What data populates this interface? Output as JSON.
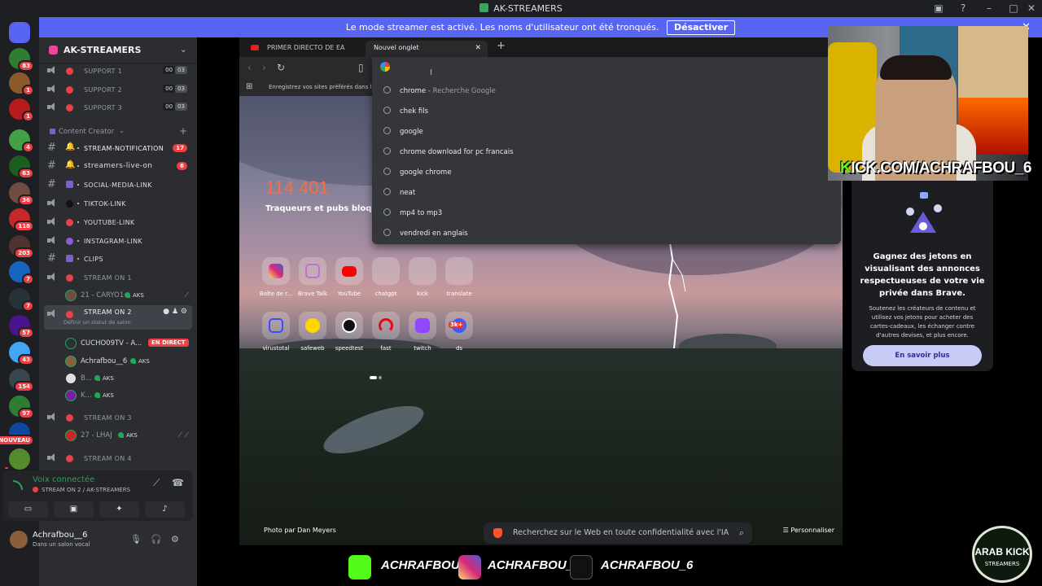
{
  "window": {
    "title": "AK-STREAMERS"
  },
  "banner": {
    "text": "Le mode streamer est activé. Les noms d'utilisateur ont été tronqués.",
    "button": "Désactiver"
  },
  "guild_badges": [
    "83",
    "1",
    "1",
    "4",
    "63",
    "36",
    "118",
    "203",
    "7",
    "7",
    "57",
    "43",
    "154",
    "97",
    "NOUVEAU"
  ],
  "server": {
    "name": "AK-STREAMERS"
  },
  "channels": {
    "support1": {
      "label": "SUPPORT 1",
      "c1": "00",
      "c2": "03"
    },
    "support2": {
      "label": "SUPPORT 2",
      "c1": "00",
      "c2": "03"
    },
    "support3": {
      "label": "SUPPORT 3",
      "c1": "00",
      "c2": "03"
    },
    "category": "Content Creator",
    "stream_notification": {
      "label": "STREAM-NOTIFICATION",
      "badge": "17"
    },
    "streamers_live_on": {
      "label": "streamers-live-on",
      "badge": "6"
    },
    "social_media_link": {
      "label": "SOCIAL-MEDIA-LINK"
    },
    "tiktok_link": {
      "label": "TIKTOK-LINK"
    },
    "youtube_link": {
      "label": "YOUTUBE-LINK"
    },
    "instagram_link": {
      "label": "INSTAGRAM-LINK"
    },
    "clips": {
      "label": "CLIPS"
    },
    "stream_on_1": {
      "label": "STREAM ON 1"
    },
    "stream_on_2": {
      "label": "STREAM ON 2",
      "status": "Définir un statut de salon"
    },
    "stream_on_3": {
      "label": "STREAM ON 3"
    },
    "stream_on_4": {
      "label": "STREAM ON 4"
    }
  },
  "voice_users": {
    "caryo": {
      "name": "21 - CARYO1",
      "tag": "AKS"
    },
    "cucho": {
      "name": "CUCHO09TV - A...",
      "live": "EN DIRECT"
    },
    "achraf": {
      "name": "Achrafbou__6",
      "tag": "AKS"
    },
    "b": {
      "name": "B...",
      "tag": "AKS"
    },
    "k": {
      "name": "K...",
      "tag": "AKS"
    },
    "lhaj": {
      "name": "27 - LHAJ",
      "tag": "AKS"
    }
  },
  "voice_panel": {
    "status": "Voix connectée",
    "channel": "STREAM ON 2 / AK-STREAMERS"
  },
  "user_panel": {
    "name": "Achrafbou__6",
    "status": "Dans un salon vocal"
  },
  "browser": {
    "tab1": "PRIMER DIRECTO DE EA SPORTS",
    "tab2": "Nouvel onglet",
    "bookmarks_hint": "Enregistrez vos sites préférés dans la b",
    "suggestions": [
      {
        "text": "chrome",
        "sub": " - Recherche Google"
      },
      {
        "text": "chek fils",
        "sub": ""
      },
      {
        "text": "google",
        "sub": ""
      },
      {
        "text": "chrome download for pc francais",
        "sub": ""
      },
      {
        "text": "google chrome",
        "sub": ""
      },
      {
        "text": "neat",
        "sub": ""
      },
      {
        "text": "mp4 to mp3",
        "sub": ""
      },
      {
        "text": "vendredi en anglais",
        "sub": ""
      }
    ],
    "stats_number": "114 401",
    "stats_label": "Traqueurs et pubs bloqué",
    "tiles_row1": [
      "Boîte de r...",
      "Brave Talk",
      "YouTube",
      "chatgpt",
      "kick",
      "translate"
    ],
    "tiles_row2": [
      "virustotal",
      "safeweb",
      "speedtest",
      "fast",
      "twitch",
      "ds"
    ],
    "ds_badge": "3k+",
    "photo_credit": "Photo par Dan Meyers",
    "customize": "Personnaliser",
    "search_placeholder": "Recherchez sur le Web en toute confidentialité avec l'IA"
  },
  "ad_card": {
    "headline": "Gagnez des jetons en visualisant des annonces respectueuses de votre vie privée dans Brave.",
    "body": "Soutenez les créateurs de contenu et utilisez vos jetons pour acheter des cartes-cadeaux, les échanger contre d'autres devises, et plus encore.",
    "button": "En savoir plus"
  },
  "overlay": {
    "kick_url_k": "K",
    "kick_url_rest": "ICK.COM/ACHRAFBOU_6",
    "handle_kick": "ACHRAFBOU_6",
    "handle_instagram": "ACHRAFBOU_6",
    "handle_tiktok": "ACHRAFBOU_6",
    "badge_top": "ARAB KICK",
    "badge_bottom": "STREAMERS"
  }
}
